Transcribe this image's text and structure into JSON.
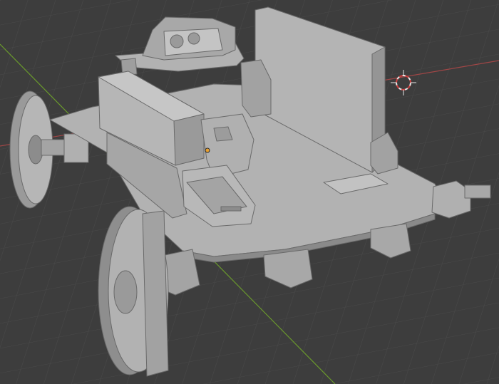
{
  "viewport": {
    "background": "#3d3d3d",
    "grid_color": "#4a4a4a",
    "x_axis_color": "#a04646",
    "y_axis_color": "#6a9a2c",
    "origin_dot_color": "#e8a030"
  },
  "model": {
    "base_color": "#a9a9a9",
    "light_color": "#bebebe",
    "shadow_color": "#8c8c8c",
    "edge_color": "#6a6a6a",
    "sensor_front_color": "#c4c4c4",
    "cursor_colors": [
      "#e8e8e8",
      "#d04040"
    ]
  }
}
